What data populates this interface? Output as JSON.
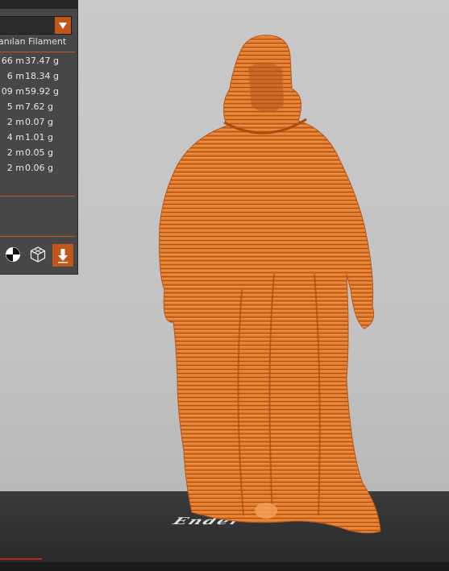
{
  "panel": {
    "header": "anılan Filament",
    "rows": [
      {
        "length": "66 m",
        "weight": "37.47 g"
      },
      {
        "length": "6 m",
        "weight": "18.34 g"
      },
      {
        "length": "09 m",
        "weight": "59.92 g"
      },
      {
        "length": "5 m",
        "weight": "7.62 g"
      },
      {
        "length": "2 m",
        "weight": "0.07 g"
      },
      {
        "length": "4 m",
        "weight": "1.01 g"
      },
      {
        "length": "2 m",
        "weight": "0.05 g"
      },
      {
        "length": "2 m",
        "weight": "0.06 g"
      }
    ],
    "icons": [
      "color-scheme-icon",
      "view-3d-icon",
      "download-icon"
    ]
  },
  "viewport": {
    "plate_logo": "Ender",
    "model_color": "#e07a2a"
  },
  "colors": {
    "accent": "#c2571b",
    "panel_bg": "#474747",
    "viewport_bg": "#c6c6c6"
  }
}
